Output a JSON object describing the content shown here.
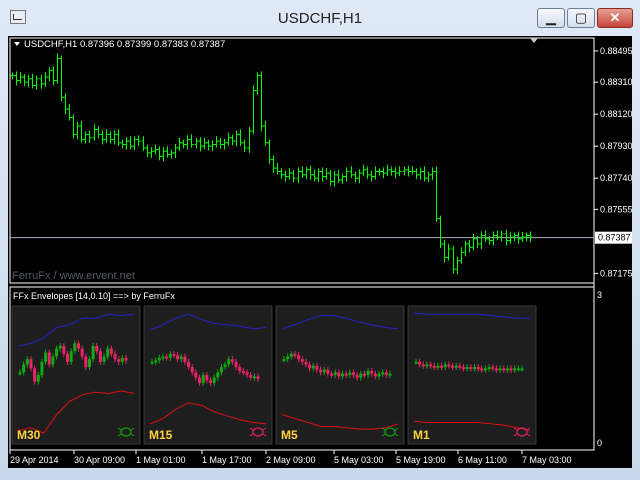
{
  "window": {
    "title": "USDCHF,H1",
    "minimize_glyph": "▁",
    "maximize_glyph": "▢",
    "close_glyph": "✕"
  },
  "main_chart": {
    "header": "USDCHF,H1  0.87396 0.87399 0.87383 0.87387",
    "watermark": "FerruFx / www.ervent.net",
    "current_price_label": "0.87387",
    "price_ticks": [
      "0.88495",
      "0.88310",
      "0.88120",
      "0.87930",
      "0.87740",
      "0.87555",
      "0.87175"
    ],
    "price_range": [
      0.8713,
      0.8856
    ],
    "candle_color": "#00ff00",
    "price_closes": [
      0.8835,
      0.8832,
      0.8834,
      0.8831,
      0.8833,
      0.8829,
      0.8833,
      0.883,
      0.8834,
      0.8838,
      0.8832,
      0.8845,
      0.8822,
      0.8815,
      0.881,
      0.88,
      0.8805,
      0.8797,
      0.88,
      0.8798,
      0.8803,
      0.88,
      0.8797,
      0.88,
      0.8797,
      0.88,
      0.8795,
      0.8794,
      0.8796,
      0.8793,
      0.8797,
      0.8796,
      0.8792,
      0.8789,
      0.879,
      0.8791,
      0.8787,
      0.879,
      0.8788,
      0.8789,
      0.8792,
      0.8795,
      0.8794,
      0.8797,
      0.8794,
      0.8796,
      0.8793,
      0.8795,
      0.8793,
      0.8794,
      0.8796,
      0.8794,
      0.8795,
      0.8798,
      0.8796,
      0.88,
      0.8795,
      0.8792,
      0.8802,
      0.8826,
      0.8835,
      0.8805,
      0.8795,
      0.8785,
      0.878,
      0.8778,
      0.8776,
      0.8775,
      0.8777,
      0.8774,
      0.8778,
      0.8776,
      0.8779,
      0.8776,
      0.8774,
      0.8778,
      0.8775,
      0.8777,
      0.8772,
      0.8776,
      0.8773,
      0.8775,
      0.8778,
      0.8776,
      0.8774,
      0.8777,
      0.8779,
      0.8776,
      0.8775,
      0.8778,
      0.8778,
      0.8777,
      0.8779,
      0.8778,
      0.8777,
      0.8778,
      0.8779,
      0.8778,
      0.8778,
      0.8776,
      0.8778,
      0.8774,
      0.8776,
      0.8778,
      0.875,
      0.8735,
      0.8727,
      0.8732,
      0.872,
      0.8725,
      0.873,
      0.8735,
      0.8733,
      0.8738,
      0.8735,
      0.874,
      0.8738,
      0.8737,
      0.874,
      0.8739,
      0.8741,
      0.8737,
      0.8739,
      0.874,
      0.8738,
      0.8739,
      0.874,
      0.8739
    ]
  },
  "indicator": {
    "label": "FFx Envelopes [14,0.10] ==> by FerruFx",
    "scale_top": "3",
    "scale_bottom": "0",
    "colors": {
      "upper": "#2222cc",
      "lower": "#dd1111",
      "bull": "#11aa11",
      "bear": "#ee2266",
      "label": "#ffd23f"
    },
    "panels": [
      {
        "tf": "M30",
        "upper": [
          0.72,
          0.74,
          0.78,
          0.86,
          0.88,
          0.93,
          0.93,
          0.96,
          0.95,
          0.96
        ],
        "lower": [
          0.08,
          0.1,
          0.06,
          0.2,
          0.3,
          0.35,
          0.37,
          0.36,
          0.38,
          0.36
        ],
        "closes": [
          0.52,
          0.58,
          0.62,
          0.55,
          0.45,
          0.5,
          0.6,
          0.67,
          0.58,
          0.64,
          0.7,
          0.72,
          0.66,
          0.6,
          0.68,
          0.74,
          0.7,
          0.64,
          0.56,
          0.62,
          0.72,
          0.68,
          0.6,
          0.64,
          0.7,
          0.66,
          0.62,
          0.6,
          0.63,
          0.61
        ]
      },
      {
        "tf": "M15",
        "upper": [
          0.84,
          0.88,
          0.93,
          0.96,
          0.92,
          0.89,
          0.88,
          0.87,
          0.85,
          0.86
        ],
        "lower": [
          0.13,
          0.17,
          0.24,
          0.29,
          0.27,
          0.22,
          0.19,
          0.16,
          0.14,
          0.13
        ],
        "closes": [
          0.6,
          0.61,
          0.63,
          0.64,
          0.63,
          0.66,
          0.65,
          0.62,
          0.64,
          0.6,
          0.56,
          0.52,
          0.48,
          0.44,
          0.5,
          0.46,
          0.44,
          0.48,
          0.52,
          0.56,
          0.58,
          0.62,
          0.6,
          0.56,
          0.53,
          0.52,
          0.5,
          0.48,
          0.49,
          0.47
        ]
      },
      {
        "tf": "M5",
        "upper": [
          0.85,
          0.88,
          0.92,
          0.95,
          0.95,
          0.93,
          0.9,
          0.88,
          0.86,
          0.85
        ],
        "lower": [
          0.2,
          0.17,
          0.14,
          0.11,
          0.11,
          0.1,
          0.09,
          0.09,
          0.1,
          0.13
        ],
        "closes": [
          0.62,
          0.64,
          0.66,
          0.65,
          0.62,
          0.6,
          0.58,
          0.55,
          0.57,
          0.54,
          0.52,
          0.54,
          0.51,
          0.5,
          0.52,
          0.49,
          0.51,
          0.5,
          0.52,
          0.5,
          0.48,
          0.51,
          0.5,
          0.53,
          0.51,
          0.49,
          0.51,
          0.52,
          0.5,
          0.51
        ]
      },
      {
        "tf": "M1",
        "upper": [
          0.97,
          0.96,
          0.96,
          0.96,
          0.96,
          0.96,
          0.95,
          0.94,
          0.93,
          0.93
        ],
        "lower": [
          0.15,
          0.14,
          0.14,
          0.14,
          0.14,
          0.14,
          0.13,
          0.12,
          0.1,
          0.08
        ],
        "closes": [
          0.6,
          0.58,
          0.57,
          0.58,
          0.57,
          0.56,
          0.57,
          0.56,
          0.58,
          0.57,
          0.56,
          0.57,
          0.56,
          0.55,
          0.56,
          0.55,
          0.56,
          0.55,
          0.54,
          0.55,
          0.56,
          0.55,
          0.54,
          0.55,
          0.54,
          0.55,
          0.54,
          0.55,
          0.55,
          0.55
        ]
      }
    ]
  },
  "time_axis": [
    "29 Apr 2014",
    "30 Apr 09:00",
    "1 May 01:00",
    "1 May 17:00",
    "2 May 09:00",
    "5 May 03:00",
    "5 May 19:00",
    "6 May 11:00",
    "7 May 03:00"
  ]
}
